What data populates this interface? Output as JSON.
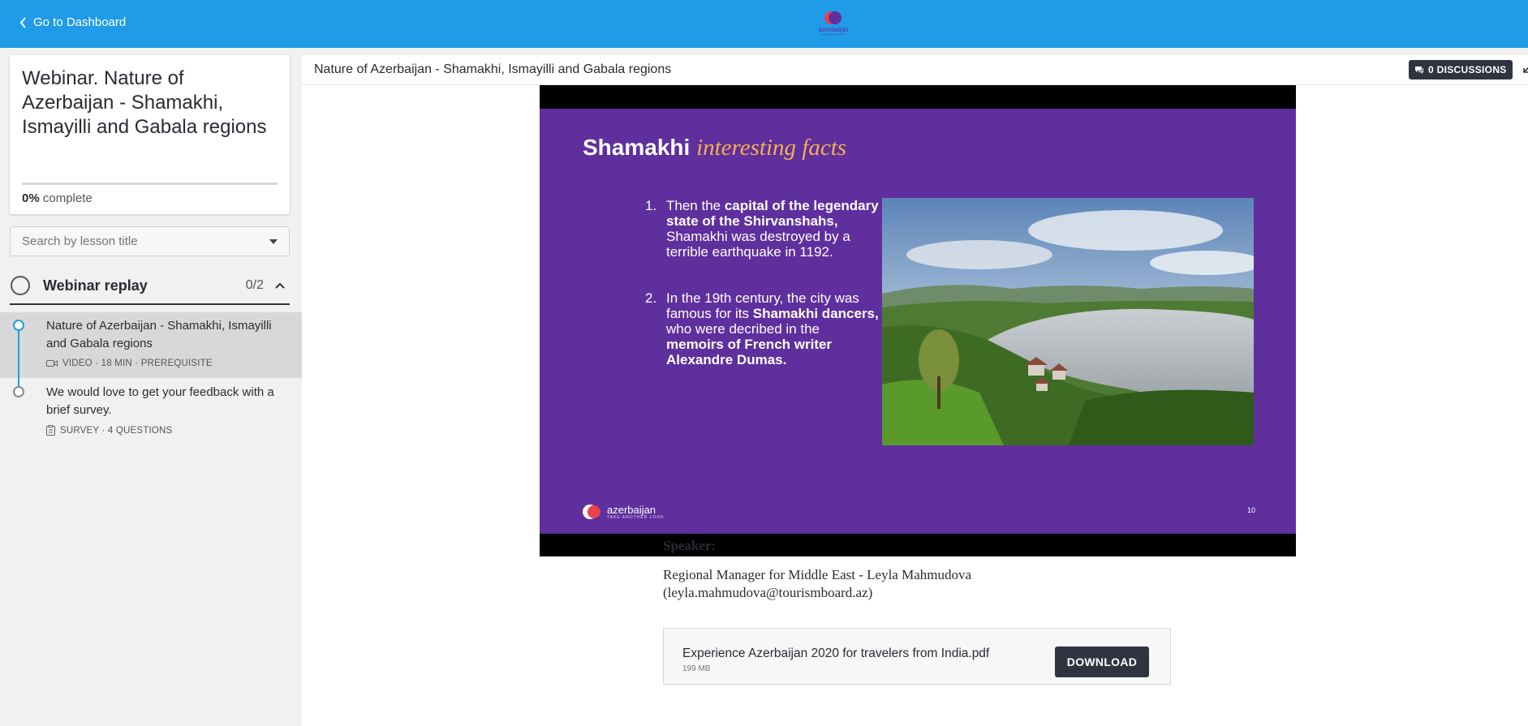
{
  "topbar": {
    "back_label": "Go to Dashboard",
    "logo_text": "azerbaijan"
  },
  "sidebar": {
    "course_title": "Webinar. Nature of Azerbaijan - Shamakhi, Ismayilli and Gabala regions",
    "progress_percent": "0%",
    "progress_value": 0,
    "progress_suffix": "complete",
    "search_placeholder": "Search by lesson title",
    "section": {
      "title": "Webinar replay",
      "count": "0/2"
    },
    "lessons": [
      {
        "title": "Nature of Azerbaijan - Shamakhi, Ismayilli and Gabala regions",
        "meta": "VIDEO · 18 MIN · PREREQUISITE",
        "icon": "video-icon"
      },
      {
        "title": "We would love to get your feedback with a brief survey.",
        "meta": "SURVEY · 4 QUESTIONS",
        "icon": "survey-icon"
      }
    ]
  },
  "main": {
    "title": "Nature of Azerbaijan - Shamakhi, Ismayilli and Gabala regions",
    "discussions_label": "0 DISCUSSIONS",
    "slide": {
      "title_plain": "Shamakhi",
      "title_italic": "interesting facts",
      "fact1_num": "1.",
      "fact1_a": "Then the ",
      "fact1_b": "capital of the legendary state of the Shirvanshahs,",
      "fact1_c": " Shamakhi was destroyed by a terrible earthquake in 1192.",
      "fact2_num": "2.",
      "fact2_a": "In the 19th century, the city was famous for its ",
      "fact2_b": "Shamakhi dancers,",
      "fact2_c": " who were decribed in the ",
      "fact2_d": "memoirs of French writer Alexandre Dumas.",
      "brand_name": "azerbaijan",
      "brand_tag": "TAKE ANOTHER LOOK",
      "page_number": "10"
    },
    "speaker_label": "Speaker:",
    "speaker_text": "Regional Manager for Middle East - Leyla Mahmudova (leyla.mahmudova@tourismboard.az)",
    "file": {
      "name": "Experience Azerbaijan 2020 for travelers from India.pdf",
      "size": "199 MB",
      "download_label": "DOWNLOAD"
    }
  },
  "colors": {
    "topbar": "#1f9be8",
    "slide_bg": "#5f2f9e",
    "accent_orange": "#f5b04e",
    "dark_button": "#2f3440"
  }
}
